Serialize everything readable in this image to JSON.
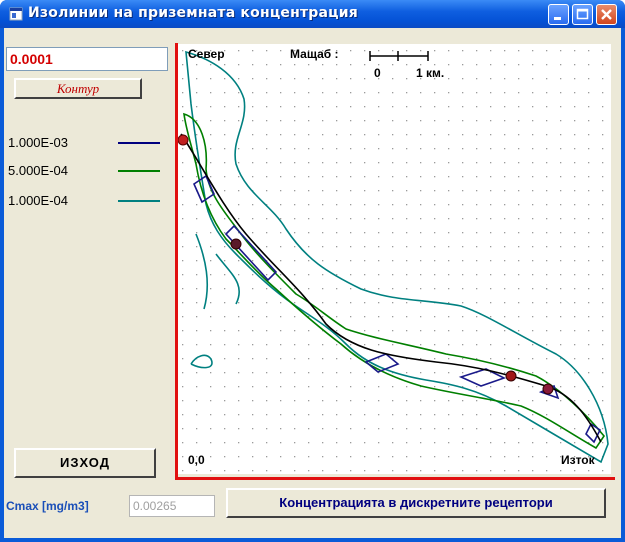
{
  "window": {
    "title": "Изолинии на приземната концентрация"
  },
  "controls": {
    "isoline_value": "0.0001",
    "contour_button": "Контур",
    "exit_button": "ИЗХОД",
    "cmax_label": "Cmax [mg/m3]",
    "cmax_value": "0.00265",
    "receptors_button": "Концентрацията в дискретните рецептори"
  },
  "legend": [
    {
      "label": "1.000E-03",
      "color": "#00007f"
    },
    {
      "label": "5.000E-04",
      "color": "#007f00"
    },
    {
      "label": "1.000E-04",
      "color": "#008080"
    }
  ],
  "map": {
    "north_label": "Север",
    "scale_label": "Мащаб :",
    "scale_zero": "0",
    "scale_one": "1 км.",
    "origin_label": "0,0",
    "east_label": "Изток"
  },
  "colors": {
    "accent_red": "#e11010",
    "titlebar_blue": "#0452d6"
  },
  "icons": [
    "app-icon",
    "minimize-icon",
    "maximize-icon",
    "close-icon"
  ]
}
